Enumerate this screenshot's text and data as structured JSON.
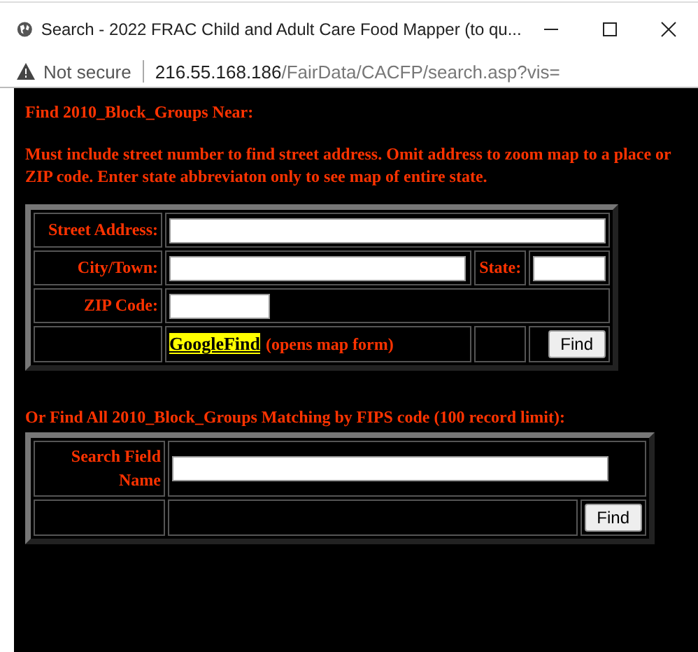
{
  "window": {
    "title": "Search - 2022 FRAC Child and Adult Care Food Mapper (to qu..."
  },
  "address_bar": {
    "security": "Not secure",
    "host": "216.55.168.186",
    "path": "/FairData/CACFP/search.asp?vis="
  },
  "heading": "Find 2010_Block_Groups Near:",
  "instructions": "Must include street number to find street address. Omit address to zoom map to a place or ZIP code. Enter state abbreviaton only to see map of entire state.",
  "address_form": {
    "street_label": "Street Address:",
    "city_label": "City/Town:",
    "state_label": "State:",
    "zip_label": "ZIP Code:",
    "google_link": "GoogleFind",
    "google_note": "(opens map form)",
    "button": "Find"
  },
  "fips_heading": "Or Find All 2010_Block_Groups Matching by FIPS code (100 record limit):",
  "fips_form": {
    "label": "Search Field Name",
    "button": "Find"
  }
}
